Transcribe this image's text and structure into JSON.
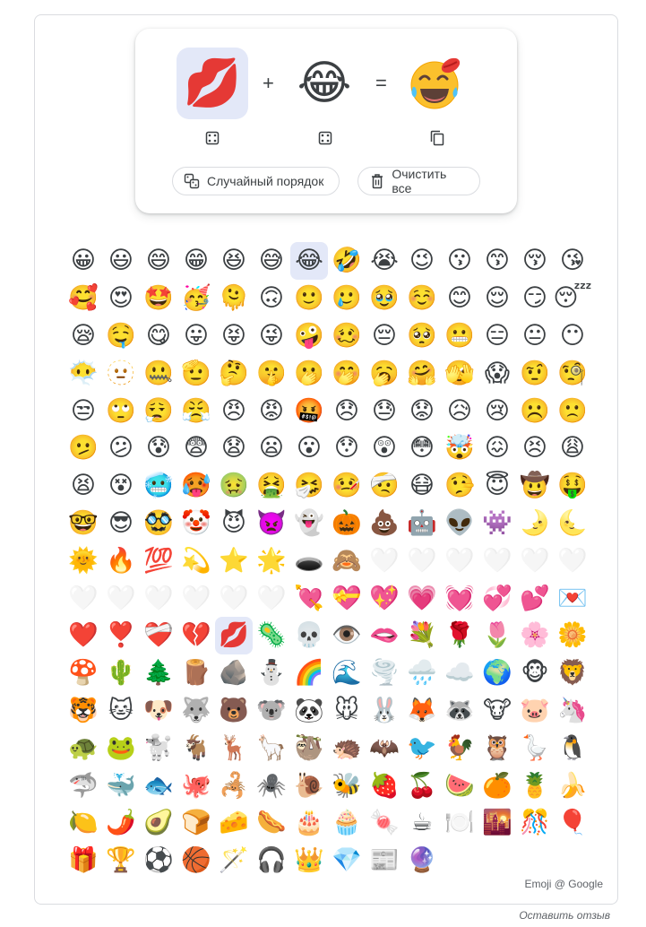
{
  "mixer": {
    "left_emoji": "💋",
    "right_emoji": "😂",
    "result_emoji": "😂💋",
    "plus": "+",
    "equals": "=",
    "left_dice_icon": "dice-icon",
    "right_dice_icon": "dice-icon",
    "copy_icon": "copy-icon"
  },
  "actions": {
    "shuffle_label": "Случайный порядок",
    "shuffle_icon": "shuffle-icon",
    "clear_label": "Очистить все",
    "clear_icon": "trash-icon"
  },
  "grid": {
    "selected_index": [
      6,
      144
    ],
    "emojis": [
      "😀",
      "😃",
      "😄",
      "😁",
      "😆",
      "😅",
      "😂",
      "🤣",
      "😭",
      "😉",
      "😗",
      "😙",
      "😚",
      "😘",
      "🥰",
      "😍",
      "🤩",
      "🥳",
      "🫠",
      "🙃",
      "🙂",
      "🥲",
      "🥹",
      "☺️",
      "😊",
      "😌",
      "😏",
      "😴",
      "😪",
      "🤤",
      "😋",
      "😛",
      "😝",
      "😜",
      "🤪",
      "🥴",
      "😔",
      "🥺",
      "😬",
      "😑",
      "😐",
      "😶",
      "😶‍🌫️",
      "🫥",
      "🤐",
      "🫡",
      "🤔",
      "🤫",
      "🫢",
      "🤭",
      "🥱",
      "🤗",
      "🫣",
      "😱",
      "🤨",
      "🧐",
      "😒",
      "🙄",
      "😮‍💨",
      "😤",
      "😠",
      "😡",
      "🤬",
      "😞",
      "😓",
      "😟",
      "😥",
      "😢",
      "☹️",
      "🙁",
      "🫤",
      "😕",
      "😰",
      "😨",
      "😧",
      "😦",
      "😮",
      "😯",
      "😲",
      "😳",
      "🤯",
      "😖",
      "😣",
      "😩",
      "😫",
      "😵",
      "🥶",
      "🥵",
      "🤢",
      "🤮",
      "🤧",
      "🤒",
      "🤕",
      "😷",
      "🤥",
      "😇",
      "🤠",
      "🤑",
      "🤓",
      "😎",
      "🥸",
      "🤡",
      "😈",
      "👿",
      "👻",
      "🎃",
      "💩",
      "🤖",
      "👽",
      "👾",
      "🌛",
      "🌜",
      "🌞",
      "🔥",
      "💯",
      "💫",
      "⭐",
      "🌟",
      "🕳️",
      "🙈",
      "🤍",
      "🤍",
      "🤍",
      "🤍",
      "🤍",
      "🤍",
      "🤍",
      "🤍",
      "🤍",
      "🤍",
      "🤍",
      "🤍",
      "💘",
      "💝",
      "💖",
      "💗",
      "💓",
      "💞",
      "💕",
      "💌",
      "❤️",
      "❣️",
      "❤️‍🩹",
      "💔",
      "💋",
      "🦠",
      "💀",
      "👁️",
      "🫦",
      "💐",
      "🌹",
      "🌷",
      "🌸",
      "🌼",
      "🍄",
      "🌵",
      "🌲",
      "🪵",
      "🪨",
      "⛄",
      "🌈",
      "🌊",
      "🌪️",
      "🌧️",
      "☁️",
      "🌍",
      "🐵",
      "🦁",
      "🐯",
      "🐱",
      "🐶",
      "🐺",
      "🐻",
      "🐨",
      "🐼",
      "🐭",
      "🐰",
      "🦊",
      "🦝",
      "🐮",
      "🐷",
      "🦄",
      "🐢",
      "🐸",
      "🐩",
      "🐐",
      "🦌",
      "🦙",
      "🦥",
      "🦔",
      "🦇",
      "🐦",
      "🐓",
      "🦉",
      "🪿",
      "🐧",
      "🦈",
      "🐳",
      "🐟",
      "🐙",
      "🦂",
      "🕷️",
      "🐌",
      "🐝",
      "🍓",
      "🍒",
      "🍉",
      "🍊",
      "🍍",
      "🍌",
      "🍋",
      "🌶️",
      "🥑",
      "🍞",
      "🧀",
      "🌭",
      "🎂",
      "🧁",
      "🍬",
      "☕",
      "🍽️",
      "🌇",
      "🎊",
      "🎈",
      "🎁",
      "🏆",
      "⚽",
      "🏀",
      "🪄",
      "🎧",
      "👑",
      "💎",
      "📰",
      "🔮"
    ],
    "faded_indices": [
      120,
      121,
      122,
      123,
      124,
      125,
      126,
      127,
      128,
      129,
      130,
      131
    ]
  },
  "footer": {
    "credit": "Emoji @ Google",
    "feedback": "Оставить отзыв"
  },
  "colors": {
    "selected_bg": "#e3e8f8",
    "border": "#dadce0",
    "text": "#3c4043"
  }
}
